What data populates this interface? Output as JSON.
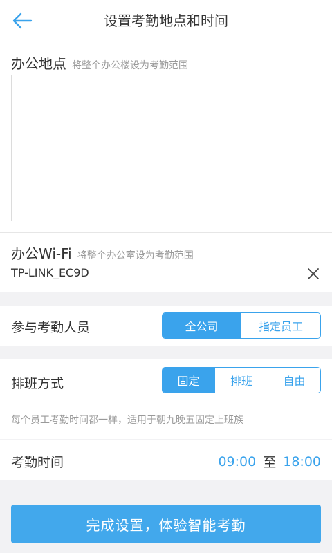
{
  "header": {
    "title": "设置考勤地点和时间",
    "back_icon": "arrow-left-icon"
  },
  "location": {
    "label": "办公地点",
    "hint": "将整个办公楼设为考勤范围"
  },
  "wifi": {
    "label": "办公Wi-Fi",
    "hint": "将整个办公室设为考勤范围",
    "value": "TP-LINK_EC9D",
    "clear_icon": "close-icon"
  },
  "people": {
    "label": "参与考勤人员",
    "options": [
      "全公司",
      "指定员工"
    ],
    "selected": "全公司"
  },
  "shift": {
    "label": "排班方式",
    "options": [
      "固定",
      "排班",
      "自由"
    ],
    "selected": "固定",
    "description": "每个员工考勤时间都一样，适用于朝九晚五固定上班族"
  },
  "time": {
    "label": "考勤时间",
    "start": "09:00",
    "separator": "至",
    "end": "18:00"
  },
  "submit": {
    "label": "完成设置，体验智能考勤"
  },
  "colors": {
    "accent": "#3aa3ec",
    "button": "#42a8ec",
    "background": "#f2f2f4",
    "hint_text": "#9a9a9a"
  }
}
